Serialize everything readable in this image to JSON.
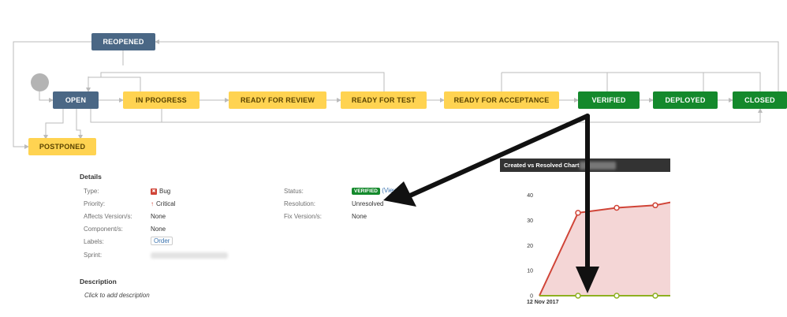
{
  "workflow": {
    "nodes": {
      "reopened": "REOPENED",
      "open": "OPEN",
      "in_progress": "IN PROGRESS",
      "ready_for_review": "READY FOR REVIEW",
      "ready_for_test": "READY FOR TEST",
      "ready_for_acceptance": "READY FOR ACCEPTANCE",
      "verified": "VERIFIED",
      "deployed": "DEPLOYED",
      "closed": "CLOSED",
      "postponed": "POSTPONED"
    },
    "colors": {
      "blue": "#4a6785",
      "yellow": "#ffd351",
      "green": "#14892c",
      "connector": "#bbbbbb"
    }
  },
  "details": {
    "title": "Details",
    "type_label": "Type:",
    "type_value": "Bug",
    "priority_label": "Priority:",
    "priority_value": "Critical",
    "affects_label": "Affects Version/s:",
    "affects_value": "None",
    "components_label": "Component/s:",
    "components_value": "None",
    "labels_label": "Labels:",
    "labels_value": "Order",
    "sprint_label": "Sprint:",
    "status_label": "Status:",
    "status_value": "VERIFIED",
    "status_link": "(View",
    "resolution_label": "Resolution:",
    "resolution_value": "Unresolved",
    "fix_label": "Fix Version/s:",
    "fix_value": "None"
  },
  "description": {
    "title": "Description",
    "placeholder": "Click to add description"
  },
  "chart_data": {
    "type": "line",
    "title": "Created vs Resolved Chart",
    "x": [
      "12 Nov 2017",
      "",
      "",
      "",
      ""
    ],
    "x_tick_label": "12 Nov 2017",
    "yticks": [
      0,
      10,
      20,
      30,
      40
    ],
    "ylim": [
      0,
      43
    ],
    "series": [
      {
        "color": "#d04437",
        "values": [
          0,
          33,
          35,
          36,
          39
        ]
      },
      {
        "color": "#8eb021",
        "values": [
          0,
          0,
          0,
          0,
          0
        ]
      }
    ],
    "area_fill": "#f4d6d6"
  }
}
